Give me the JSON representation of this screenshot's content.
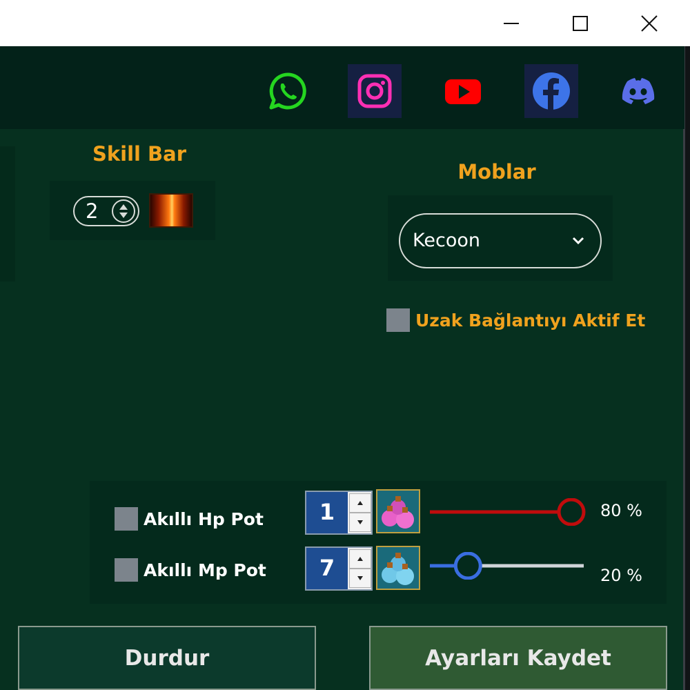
{
  "window": {
    "minimize_icon": "minimize-icon",
    "maximize_icon": "maximize-icon",
    "close_icon": "close-icon"
  },
  "social": [
    {
      "name": "whatsapp",
      "icon": "whatsapp-icon",
      "color": "#25d620"
    },
    {
      "name": "instagram",
      "icon": "instagram-icon",
      "color": "#ff2fb4"
    },
    {
      "name": "youtube",
      "icon": "youtube-icon",
      "color": "#ff0000"
    },
    {
      "name": "facebook",
      "icon": "facebook-icon",
      "color": "#3d74e8"
    },
    {
      "name": "discord",
      "icon": "discord-icon",
      "color": "#5a6ee8"
    }
  ],
  "skill_bar": {
    "title": "Skill Bar",
    "slot_value": "2",
    "skill_icon": "fire-skill-icon"
  },
  "mobs": {
    "title": "Moblar",
    "selected": "Kecoon"
  },
  "remote": {
    "label": "Uzak Bağlantıyı Aktif Et",
    "checked": false
  },
  "pots": {
    "hp": {
      "label": "Akıllı Hp Pot",
      "checked": false,
      "slot_value": "1",
      "percent": 80,
      "percent_text": "80 %",
      "color": "#c00c0c"
    },
    "mp": {
      "label": "Akıllı Mp Pot",
      "checked": false,
      "slot_value": "7",
      "percent": 20,
      "percent_text": "20 %",
      "color": "#3a6ee0"
    }
  },
  "buttons": {
    "stop": "Durdur",
    "save": "Ayarları Kaydet"
  },
  "colors": {
    "background": "#06301f",
    "accent": "#f0a21e"
  }
}
